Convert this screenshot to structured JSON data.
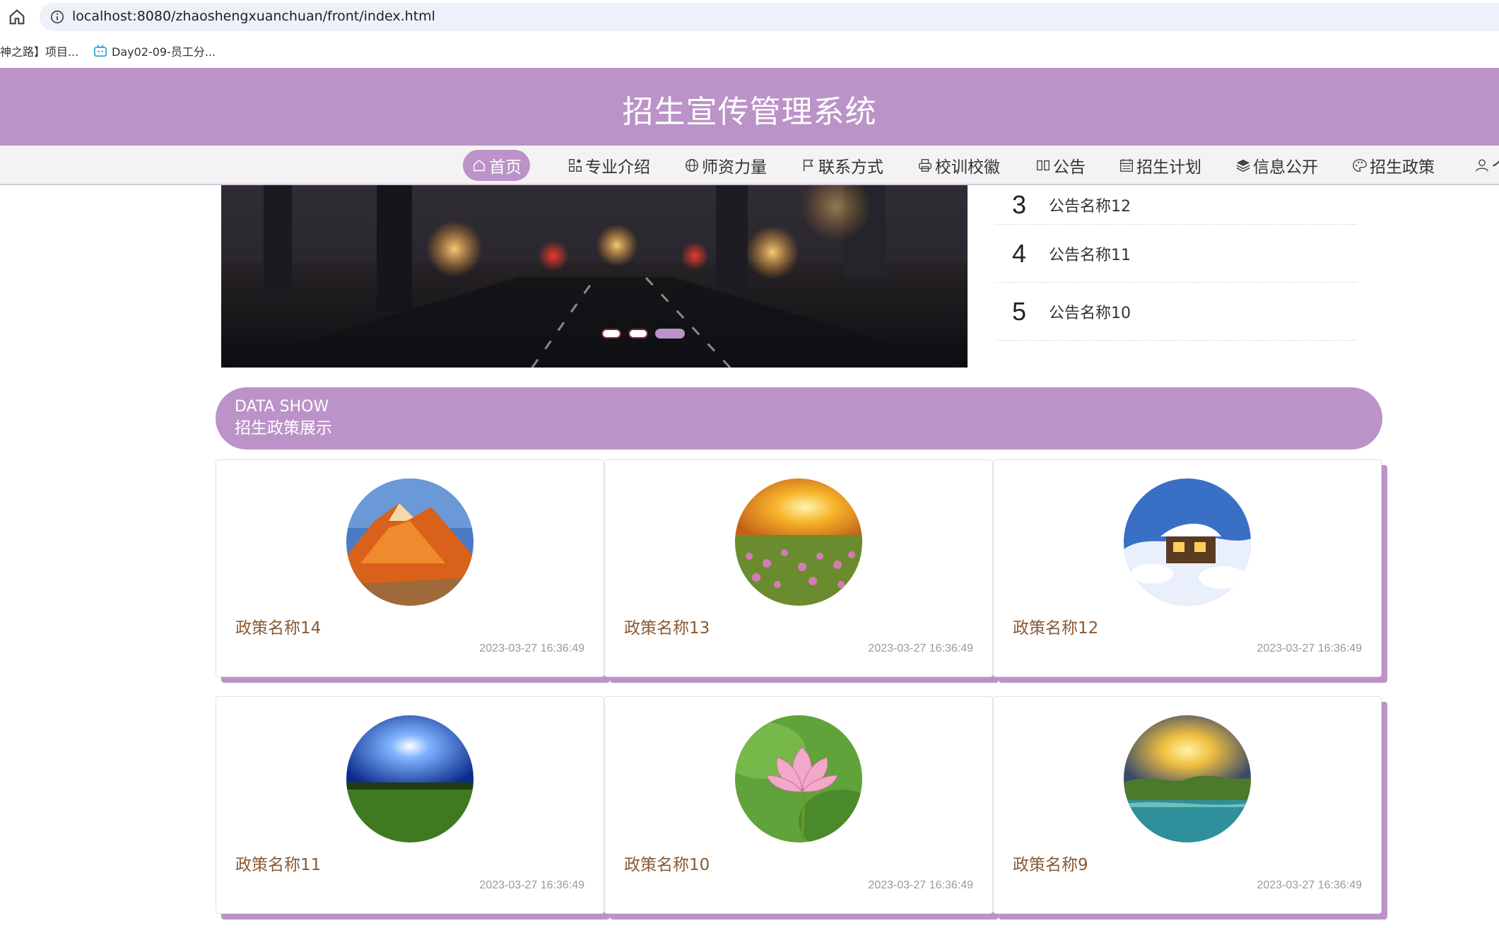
{
  "browser": {
    "url": "localhost:8080/zhaoshengxuanchuan/front/index.html",
    "bookmarks": [
      {
        "label": "神之路】项目..."
      },
      {
        "label": "Day02-09-员工分..."
      }
    ]
  },
  "header": {
    "title": "招生宣传管理系统"
  },
  "nav": {
    "items": [
      {
        "label": "首页",
        "icon": "home-icon"
      },
      {
        "label": "专业介绍",
        "icon": "grid-icon"
      },
      {
        "label": "师资力量",
        "icon": "globe-icon"
      },
      {
        "label": "联系方式",
        "icon": "flag-icon"
      },
      {
        "label": "校训校徽",
        "icon": "printer-icon"
      },
      {
        "label": "公告",
        "icon": "columns-icon"
      },
      {
        "label": "招生计划",
        "icon": "calendar-icon"
      },
      {
        "label": "信息公开",
        "icon": "layers-icon"
      },
      {
        "label": "招生政策",
        "icon": "palette-icon"
      },
      {
        "label": "个",
        "icon": "user-icon"
      }
    ]
  },
  "carousel": {
    "slide_count": 3,
    "active_index": 2
  },
  "notices": [
    {
      "num": "3",
      "title": "公告名称12"
    },
    {
      "num": "4",
      "title": "公告名称11"
    },
    {
      "num": "5",
      "title": "公告名称10"
    }
  ],
  "section": {
    "en": "DATA SHOW",
    "cn": "招生政策展示"
  },
  "policies": [
    {
      "title": "政策名称14",
      "time": "2023-03-27 16:36:49"
    },
    {
      "title": "政策名称13",
      "time": "2023-03-27 16:36:49"
    },
    {
      "title": "政策名称12",
      "time": "2023-03-27 16:36:49"
    },
    {
      "title": "政策名称11",
      "time": "2023-03-27 16:36:49"
    },
    {
      "title": "政策名称10",
      "time": "2023-03-27 16:36:49"
    },
    {
      "title": "政策名称9",
      "time": "2023-03-27 16:36:49"
    }
  ],
  "colors": {
    "brand": "#bb93c8",
    "title_brown": "#8a5a34"
  }
}
